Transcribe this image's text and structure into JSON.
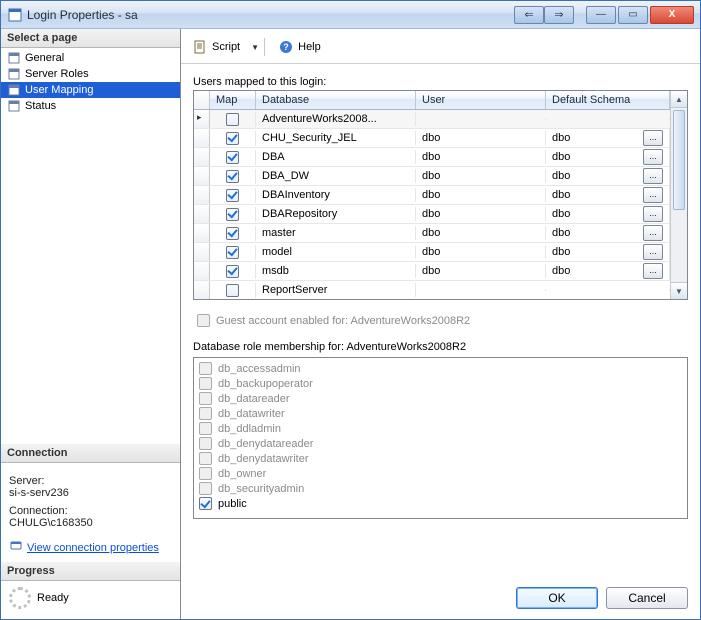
{
  "window": {
    "title": "Login Properties - sa"
  },
  "win_controls": {
    "prev": "⇐",
    "next": "⇒",
    "min": "—",
    "max": "▭",
    "close": "X"
  },
  "sidebar": {
    "header_select_page": "Select a page",
    "items": [
      {
        "label": "General"
      },
      {
        "label": "Server Roles"
      },
      {
        "label": "User Mapping"
      },
      {
        "label": "Status"
      }
    ],
    "selected_index": 2,
    "header_connection": "Connection",
    "server_label": "Server:",
    "server_value": "si-s-serv236",
    "conn_label": "Connection:",
    "conn_value": "CHULG\\c168350",
    "view_conn_link": "View connection properties",
    "header_progress": "Progress",
    "progress_text": "Ready"
  },
  "toolbar": {
    "script": "Script",
    "help": "Help"
  },
  "mapping": {
    "label": "Users mapped to this login:",
    "columns": {
      "map": "Map",
      "database": "Database",
      "user": "User",
      "schema": "Default Schema"
    },
    "rows": [
      {
        "checked": false,
        "database": "AdventureWorks2008...",
        "user": "",
        "schema": "",
        "btn": false,
        "selected": true
      },
      {
        "checked": true,
        "database": "CHU_Security_JEL",
        "user": "dbo",
        "schema": "dbo",
        "btn": true
      },
      {
        "checked": true,
        "database": "DBA",
        "user": "dbo",
        "schema": "dbo",
        "btn": true
      },
      {
        "checked": true,
        "database": "DBA_DW",
        "user": "dbo",
        "schema": "dbo",
        "btn": true
      },
      {
        "checked": true,
        "database": "DBAInventory",
        "user": "dbo",
        "schema": "dbo",
        "btn": true
      },
      {
        "checked": true,
        "database": "DBARepository",
        "user": "dbo",
        "schema": "dbo",
        "btn": true
      },
      {
        "checked": true,
        "database": "master",
        "user": "dbo",
        "schema": "dbo",
        "btn": true
      },
      {
        "checked": true,
        "database": "model",
        "user": "dbo",
        "schema": "dbo",
        "btn": true
      },
      {
        "checked": true,
        "database": "msdb",
        "user": "dbo",
        "schema": "dbo",
        "btn": true
      },
      {
        "checked": false,
        "database": "ReportServer",
        "user": "",
        "schema": "",
        "btn": false
      }
    ],
    "ellipsis": "..."
  },
  "guest": {
    "label": "Guest account enabled for: AdventureWorks2008R2"
  },
  "roles": {
    "label": "Database role membership for: AdventureWorks2008R2",
    "items": [
      {
        "name": "db_accessadmin",
        "checked": false,
        "disabled": true
      },
      {
        "name": "db_backupoperator",
        "checked": false,
        "disabled": true
      },
      {
        "name": "db_datareader",
        "checked": false,
        "disabled": true
      },
      {
        "name": "db_datawriter",
        "checked": false,
        "disabled": true
      },
      {
        "name": "db_ddladmin",
        "checked": false,
        "disabled": true
      },
      {
        "name": "db_denydatareader",
        "checked": false,
        "disabled": true
      },
      {
        "name": "db_denydatawriter",
        "checked": false,
        "disabled": true
      },
      {
        "name": "db_owner",
        "checked": false,
        "disabled": true
      },
      {
        "name": "db_securityadmin",
        "checked": false,
        "disabled": true
      },
      {
        "name": "public",
        "checked": true,
        "disabled": false
      }
    ]
  },
  "buttons": {
    "ok": "OK",
    "cancel": "Cancel"
  }
}
